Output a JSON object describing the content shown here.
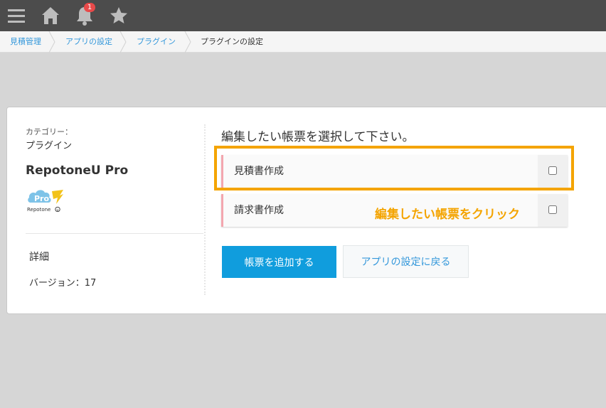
{
  "topbar": {
    "notification_count": "1",
    "icons": [
      "menu-icon",
      "home-icon",
      "bell-icon",
      "star-icon"
    ]
  },
  "breadcrumb": {
    "items": [
      "見積管理",
      "アプリの設定",
      "プラグイン"
    ],
    "current": "プラグインの設定"
  },
  "plugin": {
    "category_label": "カテゴリー：",
    "category": "プラグイン",
    "name": "RepotoneU Pro",
    "logo_text": "Pro",
    "logo_brand": "Repotone",
    "detail_label": "詳細",
    "version": "バージョン：17"
  },
  "main": {
    "heading": "編集したい帳票を選択して下さい。",
    "options": [
      {
        "label": "見積書作成",
        "checked": false
      },
      {
        "label": "請求書作成",
        "checked": false
      }
    ],
    "annotation": "編集したい帳票をクリック",
    "add_button": "帳票を追加する",
    "back_button": "アプリの設定に戻る"
  },
  "colors": {
    "topbar": "#4c4c4c",
    "accent": "#109ddd",
    "link": "#3498db",
    "highlight": "#f4a400",
    "option_border": "#f3a6ae"
  }
}
